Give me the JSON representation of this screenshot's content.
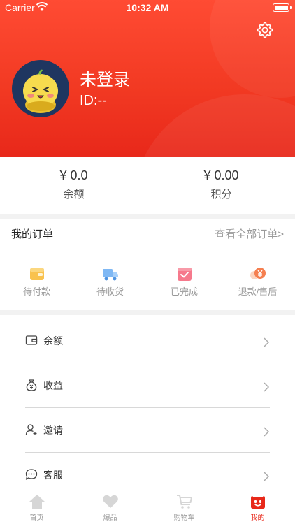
{
  "status_bar": {
    "carrier": "Carrier",
    "time": "10:32 AM"
  },
  "profile": {
    "name": "未登录",
    "id": "ID:--"
  },
  "stats": [
    {
      "value": "¥ 0.0",
      "label": "余额"
    },
    {
      "value": "¥ 0.00",
      "label": "积分"
    }
  ],
  "orders": {
    "title": "我的订单",
    "view_all": "查看全部订单>",
    "items": [
      {
        "label": "待付款",
        "icon": "wallet-icon"
      },
      {
        "label": "待收货",
        "icon": "truck-icon"
      },
      {
        "label": "已完成",
        "icon": "check-box-icon"
      },
      {
        "label": "退款/售后",
        "icon": "refund-icon"
      }
    ]
  },
  "menu": [
    {
      "label": "余额",
      "icon": "wallet-outline-icon"
    },
    {
      "label": "收益",
      "icon": "money-bag-icon"
    },
    {
      "label": "邀请",
      "icon": "add-user-icon"
    },
    {
      "label": "客服",
      "icon": "chat-bubble-icon"
    }
  ],
  "tabs": [
    {
      "label": "首页",
      "icon": "home-icon"
    },
    {
      "label": "爆品",
      "icon": "heart-icon"
    },
    {
      "label": "购物车",
      "icon": "cart-icon"
    },
    {
      "label": "我的",
      "icon": "smiley-icon"
    }
  ],
  "colors": {
    "primary": "#e8281a",
    "header_top": "#ff4b33",
    "muted": "#999999"
  }
}
